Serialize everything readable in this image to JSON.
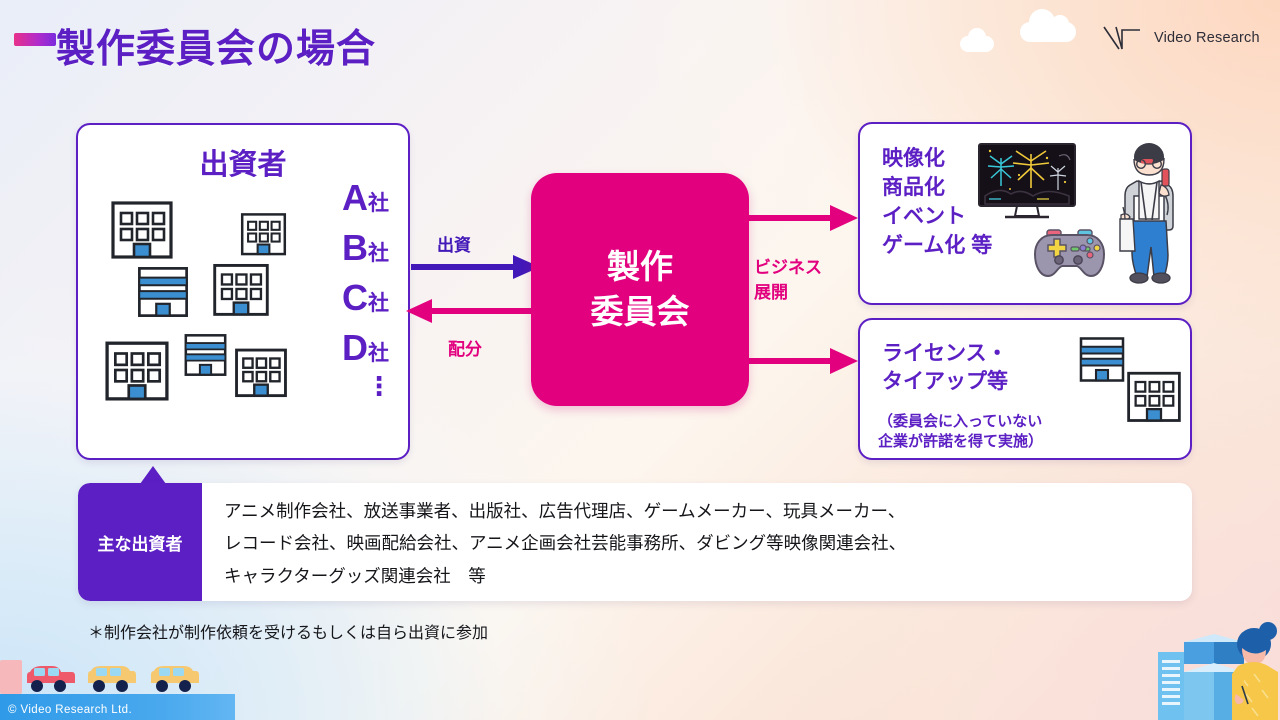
{
  "header": {
    "title": "製作委員会の場合",
    "logo_text": "Video Research",
    "accent_purple": "#5b1fc4",
    "accent_magenta": "#e2007f"
  },
  "investors_box": {
    "title": "出資者",
    "companies": [
      {
        "letter": "A",
        "suffix": "社"
      },
      {
        "letter": "B",
        "suffix": "社"
      },
      {
        "letter": "C",
        "suffix": "社"
      },
      {
        "letter": "D",
        "suffix": "社"
      }
    ],
    "ellipsis": "⋮"
  },
  "committee": {
    "line1": "製作",
    "line2": "委員会"
  },
  "arrows": {
    "investment_label": "出資",
    "distribution_label": "配分",
    "business_label_line1": "ビジネス",
    "business_label_line2": "展開"
  },
  "business_top": {
    "items": [
      "映像化",
      "商品化",
      "イベント",
      "ゲーム化 等"
    ]
  },
  "business_bottom": {
    "title": "ライセンス・\nタイアップ等",
    "note": "（委員会に入っていない\n 企業が許諾を得て実施）"
  },
  "main_investors": {
    "tag": "主な出資者",
    "lines": [
      "アニメ制作会社、放送事業者、出版社、広告代理店、ゲームメーカー、玩具メーカー、",
      "レコード会社、映画配給会社、アニメ企画会社芸能事務所、ダビング等映像関連会社、",
      "キャラクターグッズ関連会社　等"
    ]
  },
  "footnote": "＊制作会社が制作依頼を受けるもしくは自ら出資に参加",
  "footer": {
    "copyright": "© Video Research  Ltd."
  }
}
